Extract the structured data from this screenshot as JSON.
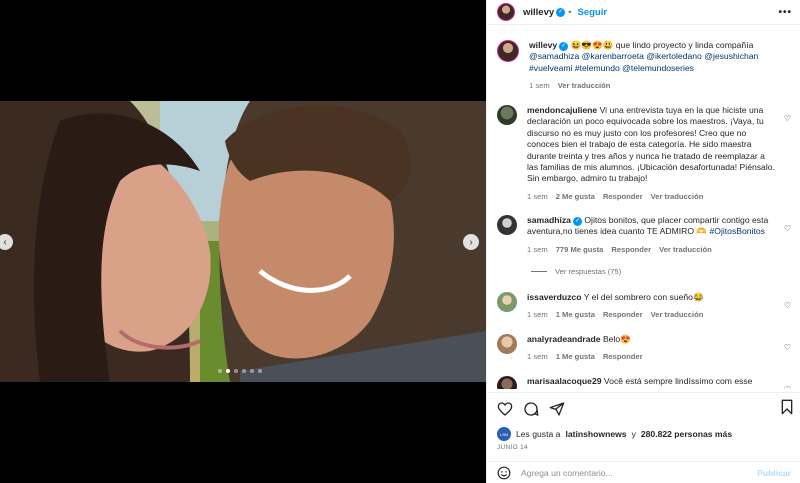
{
  "header": {
    "username": "willevy",
    "follow_label": "Seguir",
    "more_label": "•••"
  },
  "caption": {
    "username": "willevy",
    "emoji": "😆😎😍😃",
    "text": "que lindo proyecto y linda compañía",
    "tags": "@samadhiza @karenbarroeta @ikertoledano @jesushichan #vuelveami #telemundo @telemundoseries",
    "time": "1 sem",
    "translate": "Ver traducción"
  },
  "comments": [
    {
      "username": "mendoncajuliene",
      "text": "Vi una entrevista tuya en la que hiciste una declaración un poco equivocada sobre los maestros. ¡Vaya, tu discurso no es muy justo con los profesores! Creo que no conoces bien el trabajo de esta categoría. He sido maestra durante treinta y tres años y nunca he tratado de reemplazar a las familias de mis alumnos. ¡Ubicación desafortunada! Piénsalo. Sin embargo, admiro tu trabajo!",
      "time": "1 sem",
      "likes": "2 Me gusta",
      "reply": "Responder",
      "translate": "Ver traducción"
    },
    {
      "username": "samadhiza",
      "text": "Ojitos bonitos, que placer compartir contigo esta aventura,no tienes idea cuanto TE ADMIRO 🫶",
      "hashtag": "#OjitosBonitos",
      "time": "1 sem",
      "likes": "779 Me gusta",
      "reply": "Responder",
      "translate": "Ver traducción"
    },
    {
      "username": "issaverduzco",
      "text": "Y el del sombrero con sueño😂",
      "time": "1 sem",
      "likes": "1 Me gusta",
      "reply": "Responder",
      "translate": "Ver traducción"
    },
    {
      "username": "analyradeandrade",
      "text": "Belo😍",
      "time": "1 sem",
      "likes": "1 Me gusta",
      "reply": "Responder"
    },
    {
      "username": "marisaalacoque29",
      "text": "Você está sempre lindíssimo com esse"
    }
  ],
  "view_replies": "Ver respuestas (75)",
  "likes_line": {
    "prefix": "Les gusta a",
    "user": "latinshownews",
    "middle": "y",
    "count": "280.822 personas más"
  },
  "date": "JUNIO 14",
  "comment_input": {
    "placeholder": "Agrega un comentario...",
    "publish": "Publicar"
  },
  "carousel": {
    "slides": 6,
    "active": 2
  }
}
